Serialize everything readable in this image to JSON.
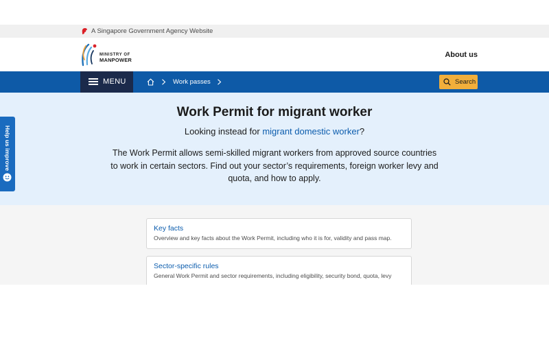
{
  "gov_banner": {
    "text": "A Singapore Government Agency Website",
    "icon": "singapore-lion-icon"
  },
  "brand": {
    "logo_line1": "MINISTRY OF",
    "logo_line2": "MANPOWER",
    "about_label": "About us"
  },
  "nav": {
    "menu_label": "MENU",
    "breadcrumb": [
      "Work passes"
    ],
    "search_label": "Search",
    "colors": {
      "bar": "#0e5aa7",
      "menu": "#1b2a4b",
      "search": "#f2af3b"
    }
  },
  "hero": {
    "title": "Work Permit for migrant worker",
    "alt_prefix": "Looking instead for ",
    "alt_link": "migrant domestic worker",
    "alt_suffix": "?",
    "description": "The Work Permit allows semi-skilled migrant workers from approved source countries to work in certain sectors. Find out your sector’s requirements, foreign worker levy and quota, and how to apply."
  },
  "feedback": {
    "label": "Help us improve",
    "icon": "smiley-icon"
  },
  "cards": [
    {
      "title": "Key facts",
      "description": "Overview and key facts about the Work Permit, including who it is for, validity and pass map."
    },
    {
      "title": "Sector-specific rules",
      "description": "General Work Permit and sector requirements, including eligibility, security bond, quota, levy"
    }
  ]
}
